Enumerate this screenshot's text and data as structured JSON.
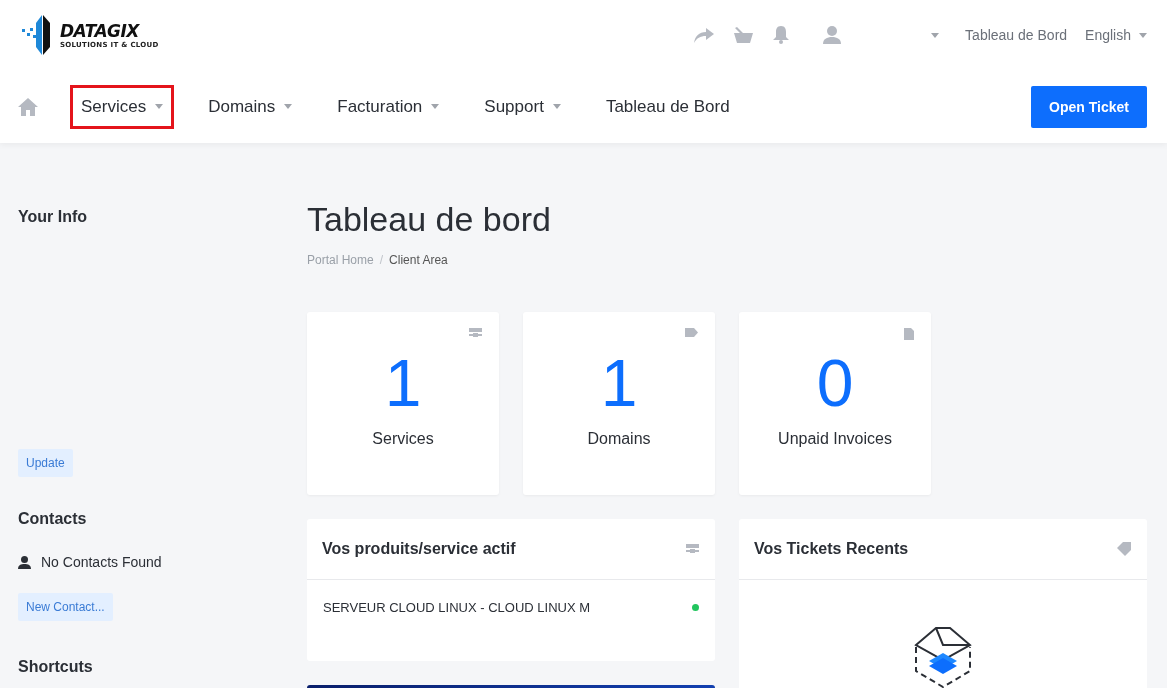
{
  "logo": {
    "name": "DATAGIX",
    "tagline": "SOLUTIONS IT & CLOUD"
  },
  "topbar": {
    "links": [
      {
        "label": "Tableau de Bord",
        "dropdown": false
      },
      {
        "label": "English",
        "dropdown": true
      }
    ]
  },
  "nav": {
    "items": [
      {
        "label": "Services",
        "dropdown": true,
        "highlighted": true
      },
      {
        "label": "Domains",
        "dropdown": true,
        "highlighted": false
      },
      {
        "label": "Facturation",
        "dropdown": true,
        "highlighted": false
      },
      {
        "label": "Support",
        "dropdown": true,
        "highlighted": false
      },
      {
        "label": "Tableau de Bord",
        "dropdown": false,
        "highlighted": false
      }
    ],
    "button": "Open Ticket"
  },
  "sidebar": {
    "your_info": {
      "title": "Your Info",
      "button": "Update"
    },
    "contacts": {
      "title": "Contacts",
      "empty": "No Contacts Found",
      "button": "New Contact..."
    },
    "shortcuts": {
      "title": "Shortcuts"
    }
  },
  "page": {
    "title": "Tableau de bord",
    "breadcrumb_separator": "/",
    "breadcrumb": [
      {
        "label": "Portal Home",
        "selected": false
      },
      {
        "label": "Client Area",
        "selected": true
      }
    ]
  },
  "stats": [
    {
      "kind": "services",
      "value": "1",
      "label": "Services"
    },
    {
      "kind": "domains",
      "value": "1",
      "label": "Domains"
    },
    {
      "kind": "invoices",
      "value": "0",
      "label": "Unpaid Invoices"
    }
  ],
  "products_panel": {
    "title": "Vos produits/service actif",
    "items": [
      {
        "name": "SERVEUR CLOUD LINUX - CLOUD LINUX M",
        "color": "#22c55e"
      }
    ]
  },
  "tickets_panel": {
    "title": "Vos Tickets Recents"
  }
}
